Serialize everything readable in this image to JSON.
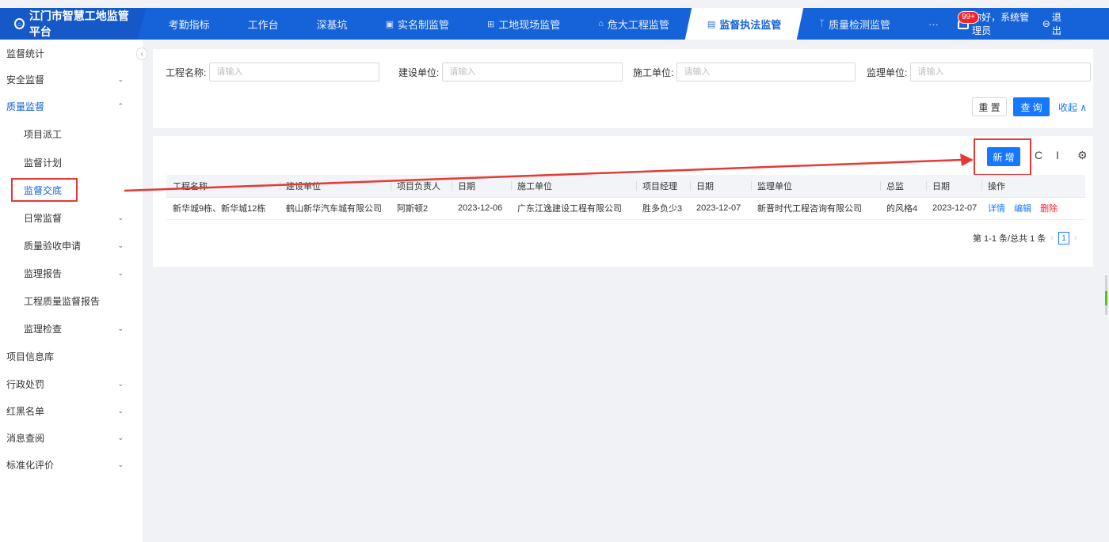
{
  "brand": {
    "title": "江门市智慧工地监管平台",
    "logo_icon": "building-logo-icon"
  },
  "nav": {
    "items": [
      {
        "label": "考勤指标",
        "icon": ""
      },
      {
        "label": "工作台",
        "icon": ""
      },
      {
        "label": "深基坑",
        "icon": ""
      },
      {
        "label": "实名制监管",
        "icon": "id-card-icon"
      },
      {
        "label": "工地现场监管",
        "icon": "grid-icon"
      },
      {
        "label": "危大工程监管",
        "icon": "building-icon"
      },
      {
        "label": "监督执法监管",
        "icon": "document-icon",
        "active": true
      },
      {
        "label": "质量检测监管",
        "icon": "branch-icon"
      },
      {
        "label": "···",
        "icon": ""
      }
    ],
    "badge": "99+",
    "greeting": "你好，系统管理员",
    "logout": "退出"
  },
  "sidebar": {
    "items": [
      {
        "label": "监督统计",
        "level": 1,
        "arrow": ""
      },
      {
        "label": "安全监督",
        "level": 1,
        "arrow": "⌄"
      },
      {
        "label": "质量监督",
        "level": 1,
        "arrow": "⌃",
        "expanded": true
      },
      {
        "label": "项目派工",
        "level": 2,
        "arrow": ""
      },
      {
        "label": "监督计划",
        "level": 2,
        "arrow": ""
      },
      {
        "label": "监督交底",
        "level": 2,
        "arrow": "",
        "current": true
      },
      {
        "label": "日常监督",
        "level": 2,
        "arrow": "⌄"
      },
      {
        "label": "质量验收申请",
        "level": 2,
        "arrow": "⌄"
      },
      {
        "label": "监理报告",
        "level": 2,
        "arrow": "⌄"
      },
      {
        "label": "工程质量监督报告",
        "level": 2,
        "arrow": ""
      },
      {
        "label": "监理检查",
        "level": 2,
        "arrow": "⌄"
      },
      {
        "label": "项目信息库",
        "level": 1,
        "arrow": ""
      },
      {
        "label": "行政处罚",
        "level": 1,
        "arrow": "⌄"
      },
      {
        "label": "红黑名单",
        "level": 1,
        "arrow": "⌄"
      },
      {
        "label": "消息查阅",
        "level": 1,
        "arrow": "⌄"
      },
      {
        "label": "标准化评价",
        "level": 1,
        "arrow": "⌄"
      }
    ]
  },
  "search": {
    "fields": [
      {
        "label": "工程名称:",
        "placeholder": "请输入",
        "value": ""
      },
      {
        "label": "建设单位:",
        "placeholder": "请输入",
        "value": ""
      },
      {
        "label": "施工单位:",
        "placeholder": "请输入",
        "value": ""
      },
      {
        "label": "监理单位:",
        "placeholder": "请输入",
        "value": ""
      }
    ],
    "reset": "重 置",
    "query": "查 询",
    "collapse": "收起 ∧"
  },
  "table": {
    "add": "新 增",
    "tools": {
      "refresh": "C",
      "density": "I",
      "settings": "⚙"
    },
    "columns": [
      "工程名称",
      "建设单位",
      "项目负责人",
      "日期",
      "施工单位",
      "项目经理",
      "日期",
      "监理单位",
      "总监",
      "日期",
      "操作"
    ],
    "rows": [
      {
        "cells": [
          "新华城9栋、新华城12栋",
          "鹤山新华汽车城有限公司",
          "阿斯顿2",
          "2023-12-06",
          "广东江逸建设工程有限公司",
          "胜多负少3",
          "2023-12-07",
          "新晋时代工程咨询有限公司",
          "的风格4",
          "2023-12-07"
        ],
        "actions": {
          "detail": "详情",
          "edit": "编辑",
          "delete": "删除"
        }
      }
    ],
    "pagination": {
      "summary": "第 1-1 条/总共 1 条",
      "current": "1"
    }
  },
  "colors": {
    "primary": "#1662d8",
    "accent": "#1677ff",
    "annotation": "#e53935",
    "danger": "#f5222d"
  }
}
